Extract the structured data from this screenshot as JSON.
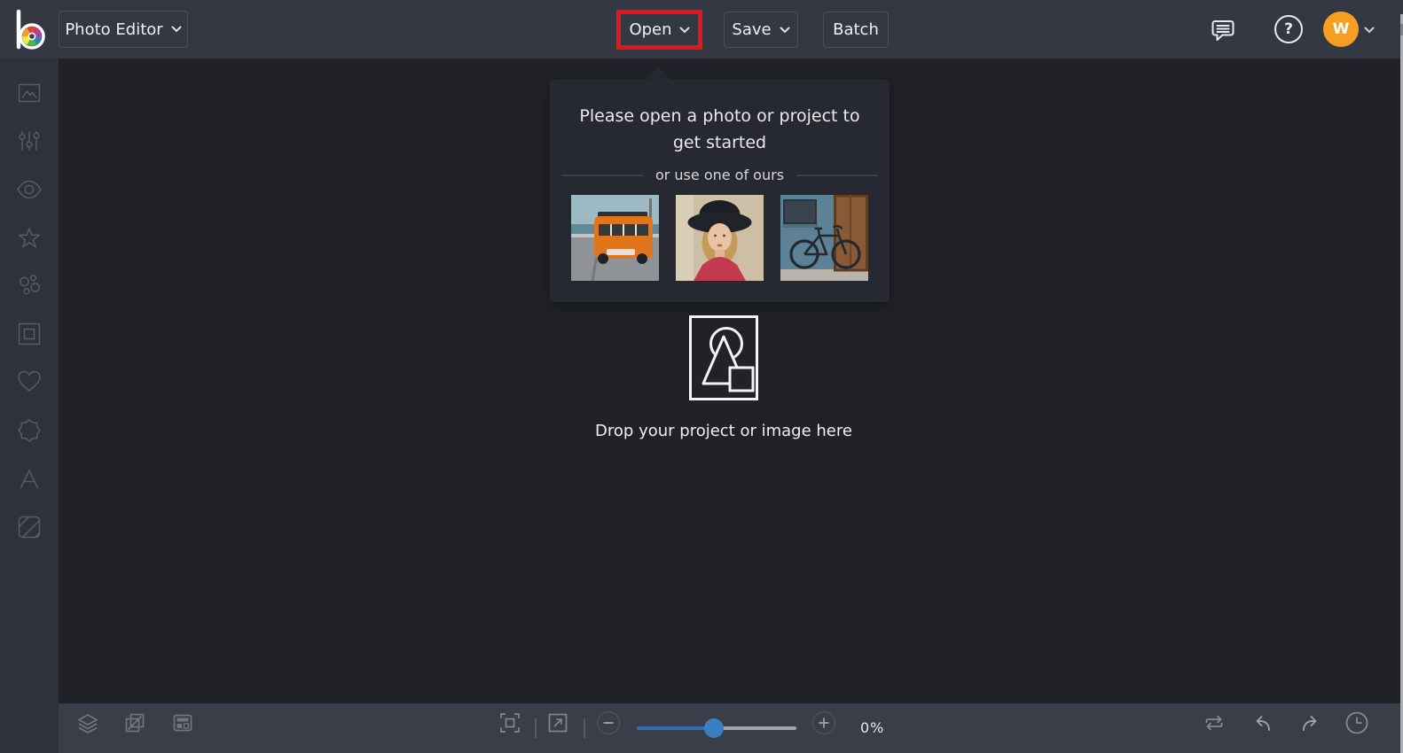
{
  "app": {
    "logo": "befunky-color-wheel-b"
  },
  "topbar": {
    "mode_selector": {
      "label": "Photo Editor"
    },
    "open_button": {
      "label": "Open"
    },
    "save_button": {
      "label": "Save"
    },
    "batch_button": {
      "label": "Batch"
    },
    "help_glyph": "?",
    "account": {
      "avatar_initial": "W",
      "avatar_color": "#f59e20"
    },
    "annotation": {
      "shape": "red-rectangle",
      "target": "open-button",
      "color": "#e8151b"
    }
  },
  "sidebar": {
    "tools": [
      "photo-icon",
      "sliders-icon",
      "eye-icon",
      "star-icon",
      "bubbles-icon",
      "frame-icon",
      "heart-icon",
      "badge-icon",
      "text-icon",
      "texture-icon"
    ]
  },
  "canvas": {
    "popover": {
      "title": "Please open a photo or project to get started",
      "divider_label": "or use one of ours",
      "samples": [
        "orange-van-photo",
        "woman-in-hat-photo",
        "bicycle-photo"
      ]
    },
    "dropzone": {
      "label": "Drop your project or image here"
    }
  },
  "bottombar": {
    "icons_left": [
      "layers-icon",
      "resize-icon",
      "panel-icon"
    ],
    "icons_center": [
      "fit-screen-icon",
      "actual-size-icon",
      "zoom-out-icon",
      "zoom-slider",
      "zoom-in-icon"
    ],
    "icons_right": [
      "compare-icon",
      "undo-icon",
      "redo-icon",
      "history-icon"
    ],
    "zoom": {
      "value": "0%"
    }
  },
  "colors": {
    "topbar": "#343843",
    "sidebar": "#2e323b",
    "canvas": "#202228",
    "popover": "#262932",
    "bottombar": "#3a3e48",
    "accent_blue": "#3c7fc0",
    "avatar_orange": "#f59e20",
    "annotation_red": "#e8151b"
  }
}
